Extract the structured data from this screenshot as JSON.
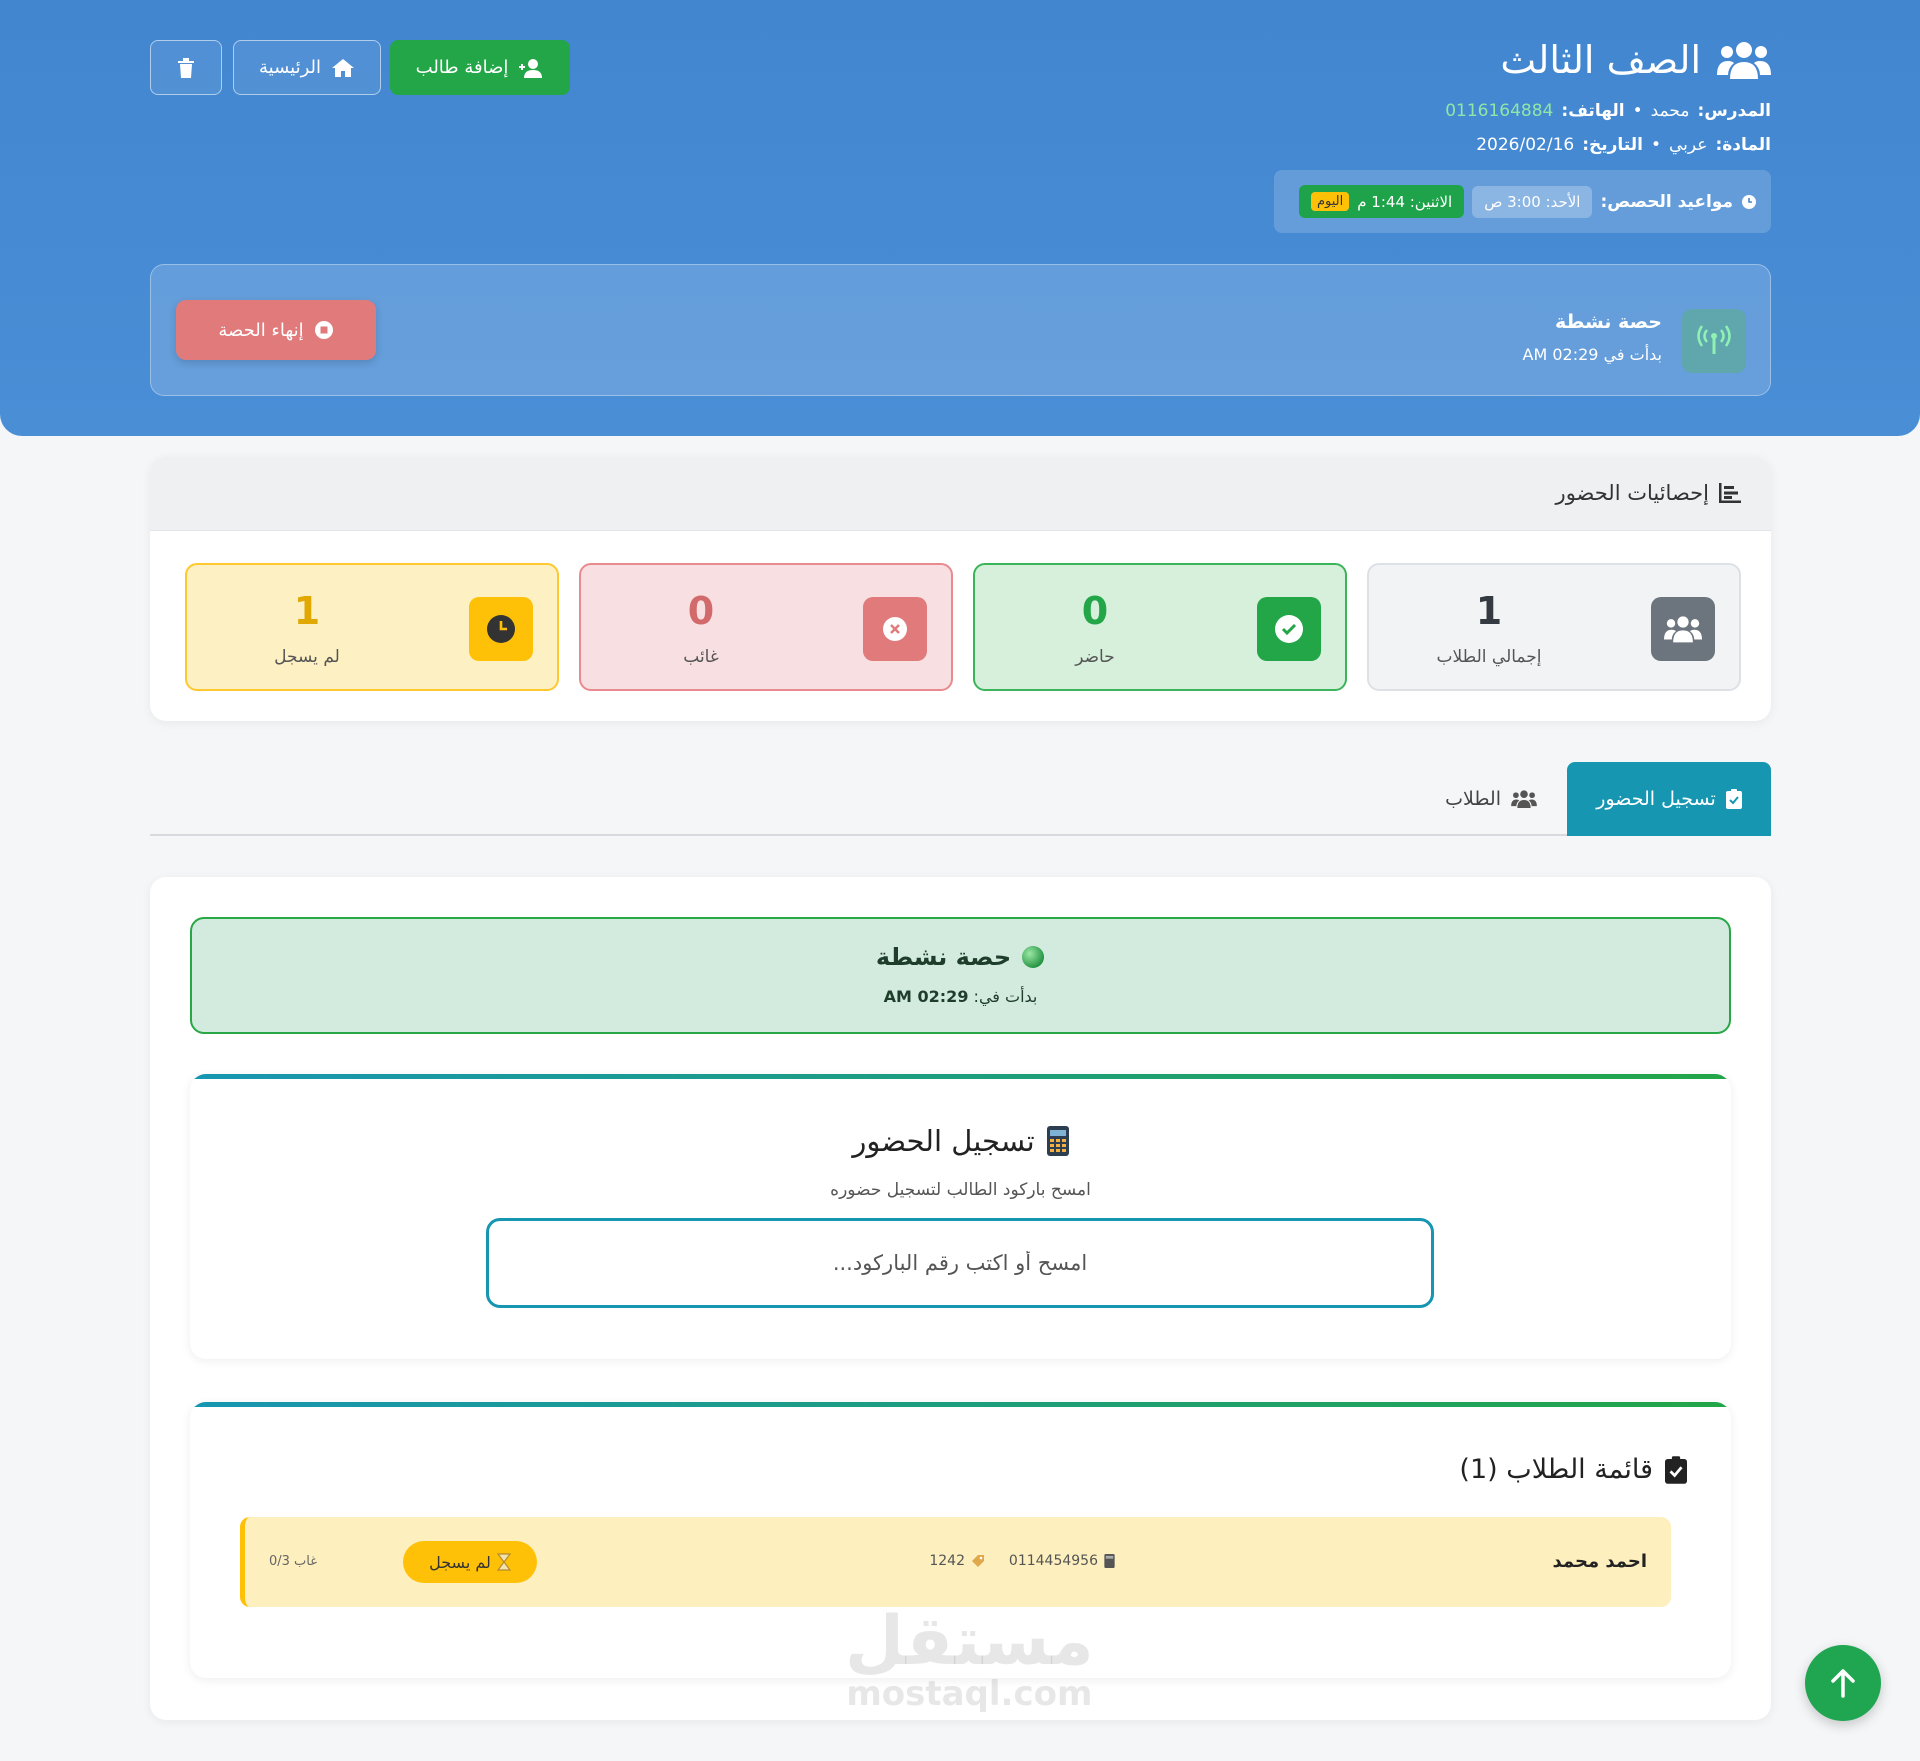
{
  "header": {
    "class_title": "الصف الثالث",
    "teacher_label": "المدرس:",
    "teacher_name": "محمد",
    "phone_label": "الهاتف:",
    "phone_value": "0116164884",
    "subject_label": "المادة:",
    "subject_value": "عربي",
    "date_label": "التاريخ:",
    "date_value": "2026/02/16",
    "schedule_label": "مواعيد الحصص:",
    "schedule": [
      {
        "text": "الأحد: 3:00 ص"
      },
      {
        "text": "الاثنين: 1:44 م",
        "badge": "اليوم"
      }
    ],
    "buttons": {
      "add_student": "إضافة طالب",
      "home": "الرئيسية"
    }
  },
  "session": {
    "title": "حصة نشطة",
    "started": "بدأت في 02:29 AM",
    "end_button": "إنهاء الحصة"
  },
  "stats": {
    "title": "إحصائيات الحضور",
    "items": [
      {
        "label": "إجمالي الطلاب",
        "value": "1"
      },
      {
        "label": "حاضر",
        "value": "0"
      },
      {
        "label": "غائب",
        "value": "0"
      },
      {
        "label": "لم يسجل",
        "value": "1"
      }
    ]
  },
  "tabs": {
    "attendance": "تسجيل الحضور",
    "students": "الطلاب"
  },
  "active_box": {
    "title": "حصة نشطة",
    "started_label": "بدأت في:",
    "started_time": "02:29 AM"
  },
  "scan": {
    "title": "تسجيل الحضور",
    "subtitle": "امسح باركود الطالب لتسجيل حضوره",
    "placeholder": "امسح أو اكتب رقم الباركود..."
  },
  "list": {
    "title": "قائمة الطلاب (1)",
    "students": [
      {
        "name": "احمد محمد",
        "phone": "0114454956",
        "code": "1242",
        "status": "لم يسجل",
        "absences": "غاب 0/3"
      }
    ]
  },
  "watermark": {
    "line1": "مستقل",
    "line2": "mostaql.com"
  },
  "colors": {
    "header_blue": "#4286d0",
    "accent_green": "#23a648",
    "teal": "#1796b2",
    "danger": "#e07a7b",
    "warning": "#ffc107"
  }
}
